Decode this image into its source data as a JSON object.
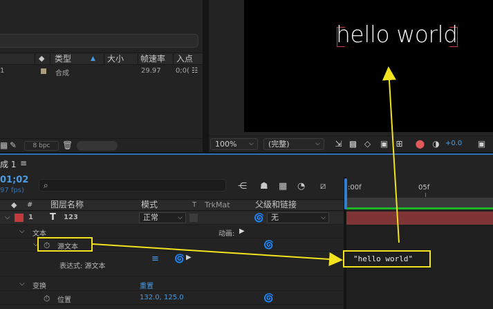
{
  "project": {
    "columns": [
      "类型",
      "大小",
      "帧速率",
      "入点"
    ],
    "row": {
      "index": "1",
      "type": "合成",
      "fps": "29.97",
      "in_point": "0;0("
    },
    "footer_bpc": "8 bpc"
  },
  "viewer": {
    "text": "hello world",
    "zoom": "100%",
    "resolution": "(完整)",
    "exposure": "+0.0"
  },
  "timeline": {
    "comp_tab": "成 1",
    "timecode": "01;02",
    "fps": "97 fps)",
    "header": {
      "number": "#",
      "layer_name": "图层名称",
      "mode": "模式",
      "t": "T",
      "trkmat": "TrkMat",
      "parent": "父级和链接"
    },
    "layer": {
      "index": "1",
      "type_glyph": "T",
      "name": "123",
      "mode": "正常",
      "parent": "无"
    },
    "rows": {
      "text_group": "文本",
      "animate": "动画:",
      "source_text": "源文本",
      "expression": "表达式: 源文本",
      "transform": "变换",
      "reset": "重置",
      "position": "位置",
      "position_value": "132.0, 125.0"
    },
    "ruler": {
      "start": ":00f",
      "mark": "05f"
    },
    "expression_result": "\"hello world\""
  },
  "colors": {
    "accent_blue": "#4a9be4",
    "label_red": "#c23a3a",
    "annotation_yellow": "#f2e31e",
    "track_green": "#1fb32a"
  }
}
